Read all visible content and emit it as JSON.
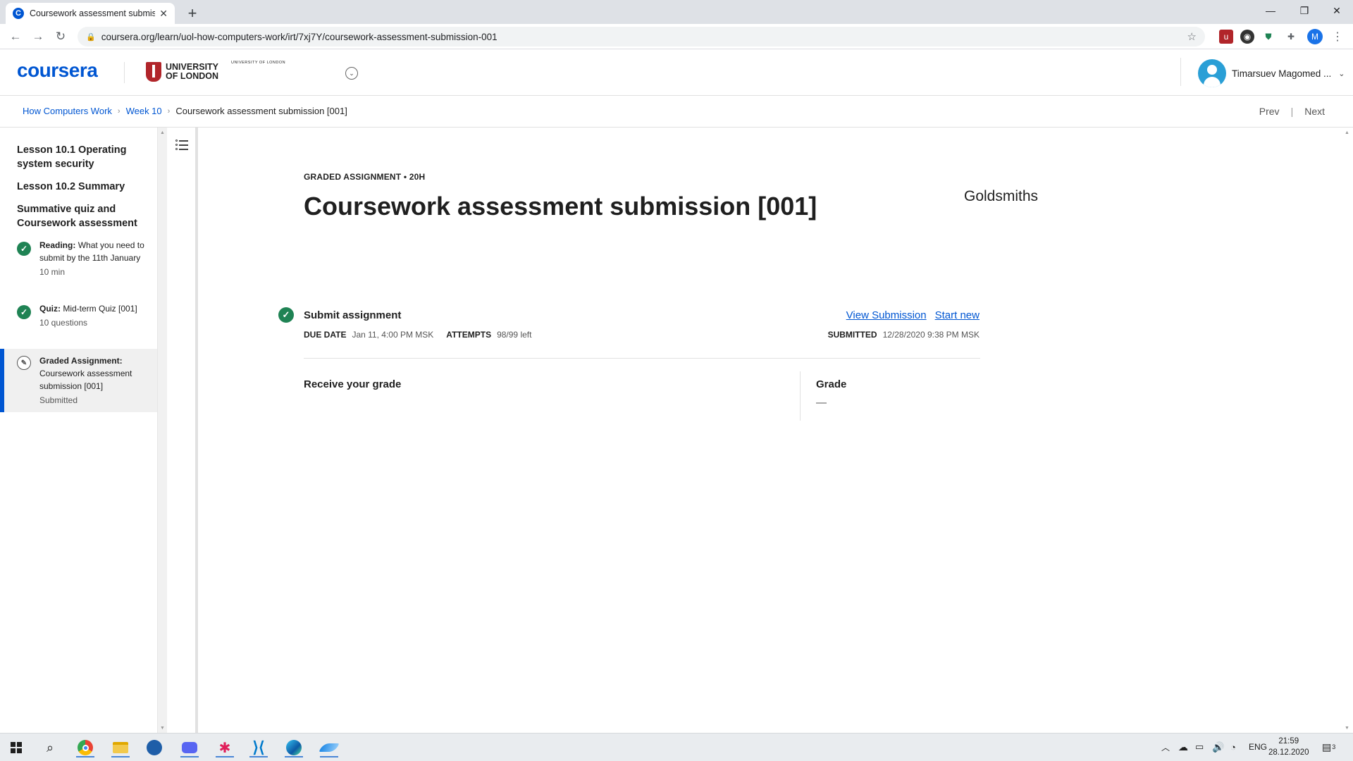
{
  "browser": {
    "tab_title": "Coursework assessment submissi",
    "favicon_letter": "C",
    "url": "coursera.org/learn/uol-how-computers-work/irt/7xj7Y/coursework-assessment-submission-001",
    "profile_initial": "M"
  },
  "header": {
    "logo": "coursera",
    "partner1_line1": "UNIVERSITY",
    "partner1_line2": "OF LONDON",
    "partner2_main": "Goldsmiths",
    "partner2_sub": "UNIVERSITY OF LONDON",
    "user_name": "Timarsuev Magomed ..."
  },
  "breadcrumb": {
    "items": [
      "How Computers Work",
      "Week 10"
    ],
    "current": "Coursework assessment submission [001]",
    "prev": "Prev",
    "next": "Next"
  },
  "sidebar": {
    "lessons": [
      "Lesson 10.1 Operating system security",
      "Lesson 10.2 Summary",
      "Summative quiz and Coursework assessment"
    ],
    "items": [
      {
        "type": "Reading:",
        "text": "What you need to submit by the 11th January",
        "meta": "10 min"
      },
      {
        "type": "Quiz:",
        "text": "Mid-term Quiz [001]",
        "meta": "10 questions"
      },
      {
        "type": "Graded Assignment:",
        "text": "Coursework assessment submission [001]",
        "meta": "Submitted"
      }
    ]
  },
  "main": {
    "eyebrow": "GRADED ASSIGNMENT • 20H",
    "title": "Coursework assessment submission [001]",
    "submit_label": "Submit assignment",
    "view_submission": "View Submission",
    "start_new": "Start new",
    "due_key": "DUE DATE",
    "due_val": "Jan 11, 4:00 PM MSK",
    "attempts_key": "ATTEMPTS",
    "attempts_val": "98/99 left",
    "submitted_key": "SUBMITTED",
    "submitted_val": "12/28/2020 9:38 PM MSK",
    "receive": "Receive your grade",
    "grade_label": "Grade",
    "grade_val": "—"
  },
  "taskbar": {
    "lang": "ENG",
    "time": "21:59",
    "date": "28.12.2020",
    "notifications": "3"
  }
}
